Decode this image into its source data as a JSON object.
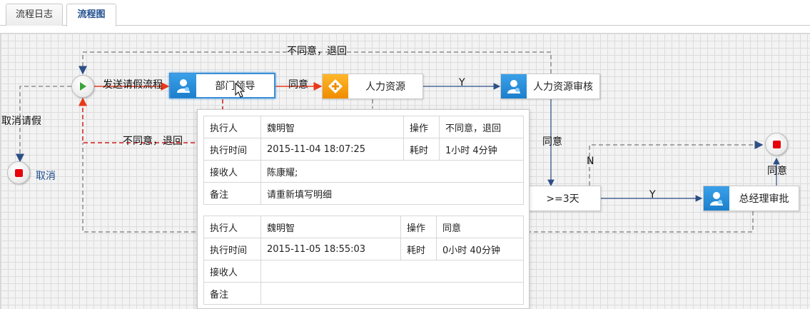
{
  "tabs": [
    {
      "label": "流程日志",
      "active": false
    },
    {
      "label": "流程图",
      "active": true
    }
  ],
  "nodes": {
    "dept_leader": "部门领导",
    "hr": "人力资源",
    "hr_review": "人力资源审核",
    "days_check": ">=3天",
    "gm_approval": "总经理审批"
  },
  "edge_labels": {
    "send_leave": "发送请假流程",
    "agree_1": "同意",
    "y_1": "Y",
    "disagree_top": "不同意，退回",
    "disagree_mid": "不同意，退回",
    "cancel_leave": "取消请假",
    "agree_2": "同意",
    "n_label": "N",
    "y_2": "Y",
    "agree_3": "同意"
  },
  "cancel_label": "取消",
  "popup": {
    "records": [
      {
        "executor_label": "执行人",
        "executor": "魏明智",
        "action_label": "操作",
        "action": "不同意，退回",
        "time_label": "执行时间",
        "time": "2015-11-04 18:07:25",
        "duration_label": "耗时",
        "duration": "1小时 4分钟",
        "receiver_label": "接收人",
        "receiver": "陈康耀;",
        "note_label": "备注",
        "note": "请重新填写明细"
      },
      {
        "executor_label": "执行人",
        "executor": "魏明智",
        "action_label": "操作",
        "action": "同意",
        "time_label": "执行时间",
        "time": "2015-11-05 18:55:03",
        "duration_label": "耗时",
        "duration": "0小时 40分钟",
        "receiver_label": "接收人",
        "receiver": "",
        "note_label": "备注",
        "note": ""
      }
    ]
  },
  "colors": {
    "active_edge": "#e8391a",
    "return_edge_active": "#d11a1a",
    "edge": "#2d4f86",
    "dashed_edge": "#8c8c8c",
    "selected_border": "#3b8fd6"
  }
}
